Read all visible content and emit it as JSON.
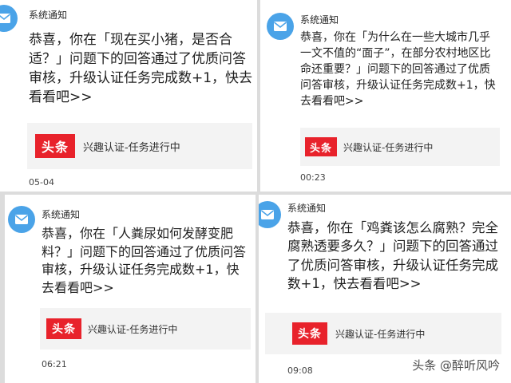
{
  "cards": [
    {
      "sender": "系统通知",
      "message": "恭喜，你在「现在买小猪，是否合适？」问题下的回答通过了优质问答审核，升级认证任务完成数+1，快去看看吧>>",
      "link": {
        "logo": "头条",
        "text": "兴趣认证-任务进行中"
      },
      "time": "05-04"
    },
    {
      "sender": "系统通知",
      "message": "恭喜，你在「为什么在一些大城市几乎一文不值的“面子”，在部分农村地区比命还重要？」问题下的回答通过了优质问答审核，升级认证任务完成数+1，快去看看吧>>",
      "link": {
        "logo": "头条",
        "text": "兴趣认证-任务进行中"
      },
      "time": "00:23"
    },
    {
      "sender": "系统通知",
      "message": "恭喜，你在「人粪尿如何发酵变肥料？」问题下的回答通过了优质问答审核，升级认证任务完成数+1，快去看看吧>>",
      "link": {
        "logo": "头条",
        "text": "兴趣认证-任务进行中"
      },
      "time": "06:21"
    },
    {
      "sender": "系统通知",
      "message": "恭喜，你在「鸡粪该怎么腐熟？完全腐熟透要多久？」问题下的回答通过了优质问答审核，升级认证任务完成数+1，快去看看吧>>",
      "link": {
        "logo": "头条",
        "text": "兴趣认证-任务进行中"
      },
      "time": "09:08"
    }
  ],
  "watermark": "头条 @醉听风吟",
  "colors": {
    "avatar": "#4aa3e8",
    "logo_red": "#e8222b",
    "link_bg": "#f3f3f3"
  },
  "icons": {
    "avatar": "mail-envelope-icon"
  }
}
